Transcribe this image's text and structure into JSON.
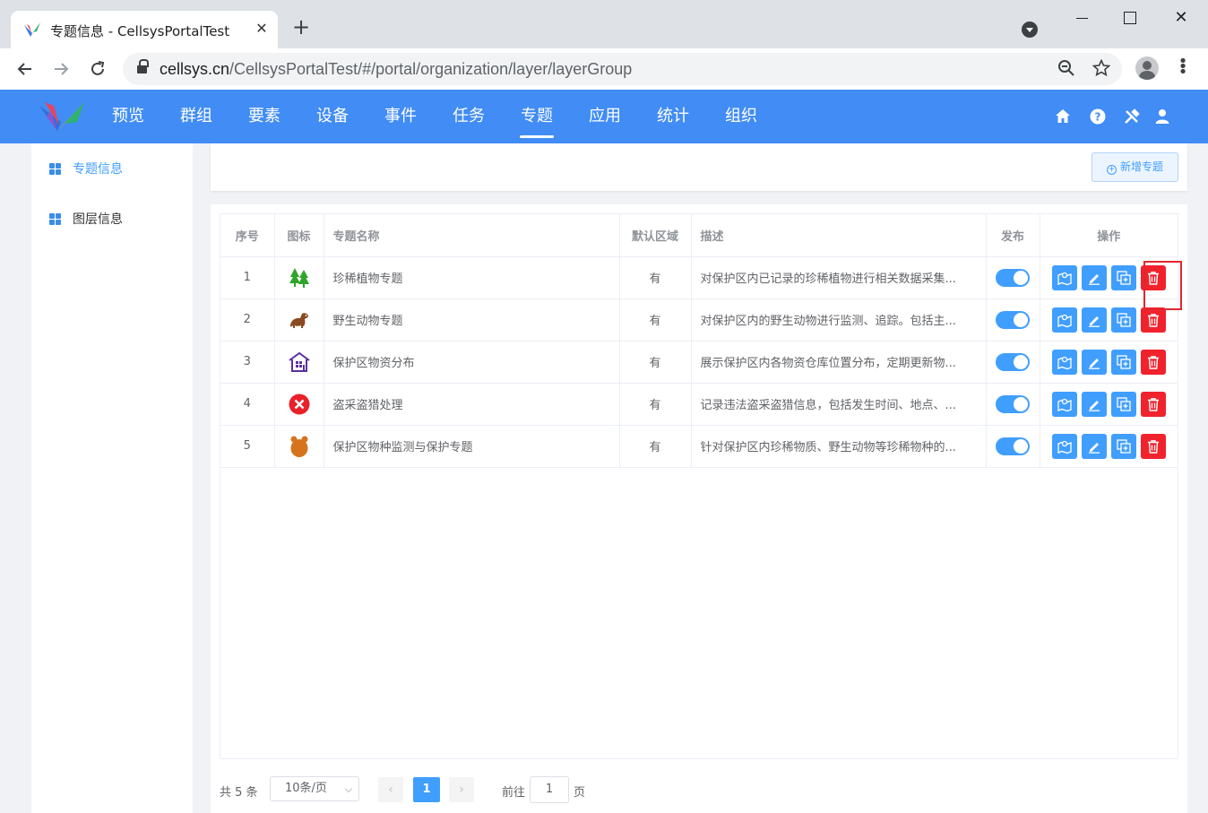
{
  "browser": {
    "tab_title": "专题信息 - CellsysPortalTest",
    "tab_close": "✕",
    "new_tab": "+",
    "url_host": "cellsys.cn",
    "url_path": "/CellsysPortalTest/#/portal/organization/layer/layerGroup",
    "window_close": "✕"
  },
  "header": {
    "menu": [
      "预览",
      "群组",
      "要素",
      "设备",
      "事件",
      "任务",
      "专题",
      "应用",
      "统计",
      "组织"
    ],
    "active_menu": "专题",
    "accent_color": "#418cf5",
    "icons": [
      "home-icon",
      "help-icon",
      "tools-icon",
      "user-icon"
    ]
  },
  "sidebar": {
    "items": [
      {
        "label": "专题信息",
        "active": true
      },
      {
        "label": "图层信息",
        "active": false
      }
    ]
  },
  "toolbar": {
    "add_label": "新增专题"
  },
  "table": {
    "columns": [
      "序号",
      "图标",
      "专题名称",
      "默认区域",
      "描述",
      "发布",
      "操作"
    ],
    "rows": [
      {
        "no": "1",
        "icon": "trees-icon",
        "name": "珍稀植物专题",
        "default_area": "有",
        "desc": "对保护区内已记录的珍稀植物进行相关数据采集...",
        "published": true
      },
      {
        "no": "2",
        "icon": "animal-icon",
        "name": "野生动物专题",
        "default_area": "有",
        "desc": "对保护区内的野生动物进行监测、追踪。包括主...",
        "published": true
      },
      {
        "no": "3",
        "icon": "warehouse-icon",
        "name": "保护区物资分布",
        "default_area": "有",
        "desc": "展示保护区内各物资仓库位置分布，定期更新物...",
        "published": true
      },
      {
        "no": "4",
        "icon": "red-x-icon",
        "name": "盗采盗猎处理",
        "default_area": "有",
        "desc": "记录违法盗采盗猎信息，包括发生时间、地点、...",
        "published": true
      },
      {
        "no": "5",
        "icon": "bear-icon",
        "name": "保护区物种监测与保护专题",
        "default_area": "有",
        "desc": "针对保护区内珍稀物质、野生动物等珍稀物种的...",
        "published": true
      }
    ],
    "ops": [
      "map-icon",
      "edit-icon",
      "copy-icon",
      "delete-icon"
    ],
    "delete_color": "#f0232d",
    "op_color": "#409eff"
  },
  "pagination": {
    "total": "共 5 条",
    "page_size": "10条/页",
    "prev": "‹",
    "next": "›",
    "current": "1",
    "goto_label": "前往",
    "goto_value": "1",
    "goto_unit": "页"
  }
}
